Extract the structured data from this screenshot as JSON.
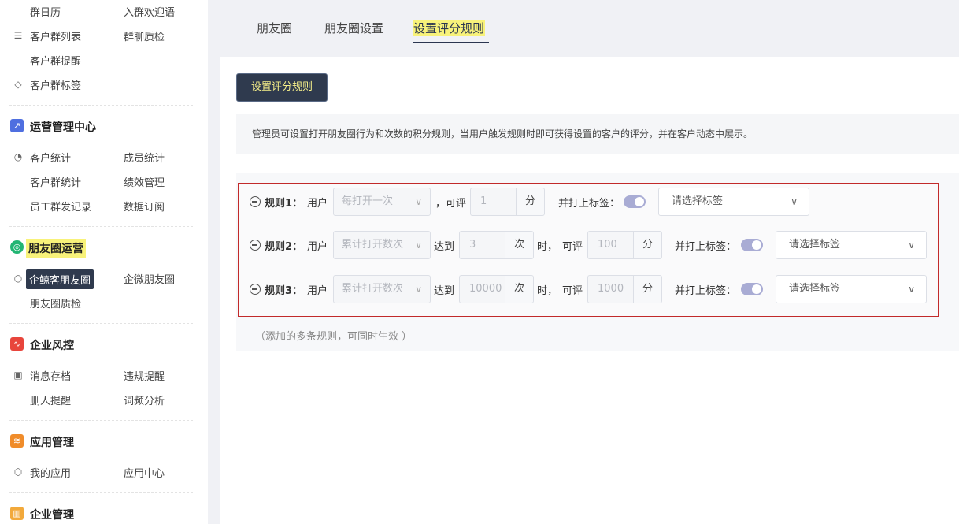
{
  "sidebar": {
    "rows1": [
      {
        "c1": "群日历",
        "c2": "入群欢迎语"
      },
      {
        "c1": "客户群列表",
        "c2": "群聊质检"
      },
      {
        "c1": "客户群提醒",
        "c2": ""
      },
      {
        "c1": "客户群标签",
        "c2": ""
      }
    ],
    "ops": {
      "title": "运营管理中心",
      "rows": [
        {
          "c1": "客户统计",
          "c2": "成员统计"
        },
        {
          "c1": "客户群统计",
          "c2": "绩效管理"
        },
        {
          "c1": "员工群发记录",
          "c2": "数据订阅"
        }
      ]
    },
    "moments": {
      "title": "朋友圈运营",
      "rows": [
        {
          "c1": "企鲸客朋友圈",
          "c2": "企微朋友圈"
        },
        {
          "c1": "朋友圈质检",
          "c2": ""
        }
      ]
    },
    "risk": {
      "title": "企业风控",
      "rows": [
        {
          "c1": "消息存档",
          "c2": "违规提醒"
        },
        {
          "c1": "删人提醒",
          "c2": "词频分析"
        }
      ]
    },
    "apps": {
      "title": "应用管理",
      "rows": [
        {
          "c1": "我的应用",
          "c2": "应用中心"
        }
      ]
    },
    "enterprise": {
      "title": "企业管理"
    }
  },
  "tabs": [
    {
      "label": "朋友圈"
    },
    {
      "label": "朋友圈设置"
    },
    {
      "label": "设置评分规则"
    }
  ],
  "main": {
    "button": "设置评分规则",
    "notice": "管理员可设置打开朋友圈行为和次数的积分规则，当用户触发规则时即可获得设置的客户的评分，并在客户动态中展示。",
    "hint": "（添加的多条规则，可同时生效 ）"
  },
  "rules": [
    {
      "label": "规则1：",
      "user": "用户",
      "behavior": "每打开一次",
      "can_rate": "，可评",
      "score": "1",
      "score_unit": "分",
      "tag_label": "并打上标签：",
      "tag_placeholder": "请选择标签"
    },
    {
      "label": "规则2：",
      "user": "用户",
      "behavior": "累计打开数次",
      "reach": "达到",
      "count": "3",
      "count_unit": "次",
      "when": "时，",
      "can_rate": "可评",
      "score": "100",
      "score_unit": "分",
      "tag_label": "并打上标签：",
      "tag_placeholder": "请选择标签"
    },
    {
      "label": "规则3：",
      "user": "用户",
      "behavior": "累计打开数次",
      "reach": "达到",
      "count": "10000",
      "count_unit": "次",
      "when": "时，",
      "can_rate": "可评",
      "score": "1000",
      "score_unit": "分",
      "tag_label": "并打上标签：",
      "tag_placeholder": "请选择标签"
    }
  ]
}
